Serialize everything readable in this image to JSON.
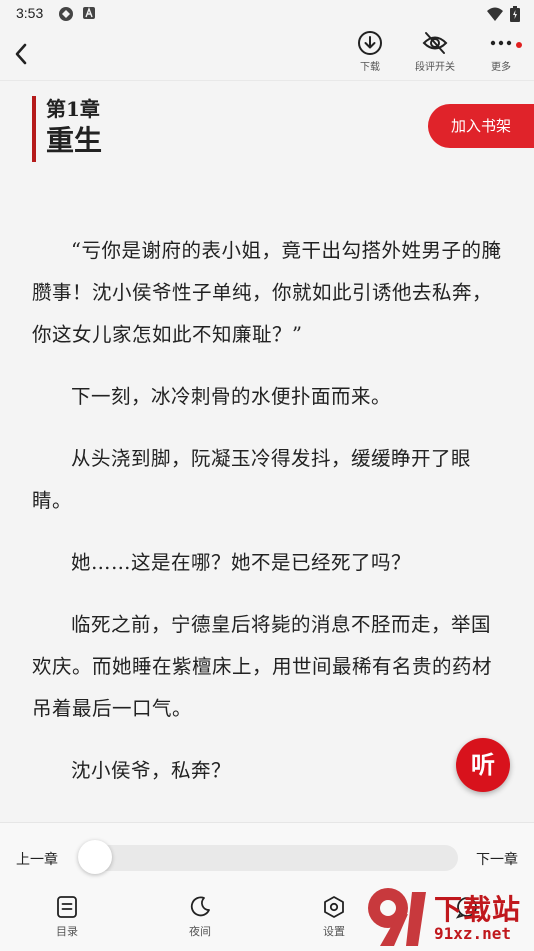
{
  "status_bar": {
    "time": "3:53"
  },
  "toolbar": {
    "download_label": "下载",
    "comments_label": "段评开关",
    "more_label": "更多"
  },
  "chapter": {
    "number": "第1章",
    "title": "重生"
  },
  "add_to_shelf": "加入书架",
  "paragraphs": [
    "“亏你是谢府的表小姐，竟干出勾搭外姓男子的腌臜事！沈小侯爷性子单纯，你就如此引诱他去私奔，你这女儿家怎如此不知廉耻？”",
    "下一刻，冰冷刺骨的水便扑面而来。",
    "从头浇到脚，阮凝玉冷得发抖，缓缓睁开了眼睛。",
    "她……这是在哪？她不是已经死了吗？",
    "临死之前，宁德皇后将毙的消息不胫而走，举国欢庆。而她睡在紫檀床上，用世间最稀有名贵的药材吊着最后一口气。",
    "沈小侯爷，私奔？"
  ],
  "listen_label": "听",
  "bottom": {
    "prev_chapter": "上一章",
    "next_chapter": "下一章",
    "progress": 0,
    "nav": {
      "toc": "目录",
      "night": "夜间",
      "settings": "设置"
    }
  },
  "watermark": {
    "text": "下载站",
    "url": "91xz.net"
  },
  "colors": {
    "accent": "#e0232a",
    "chapter_bar": "#b51b1b",
    "background": "#f4f4f4"
  }
}
